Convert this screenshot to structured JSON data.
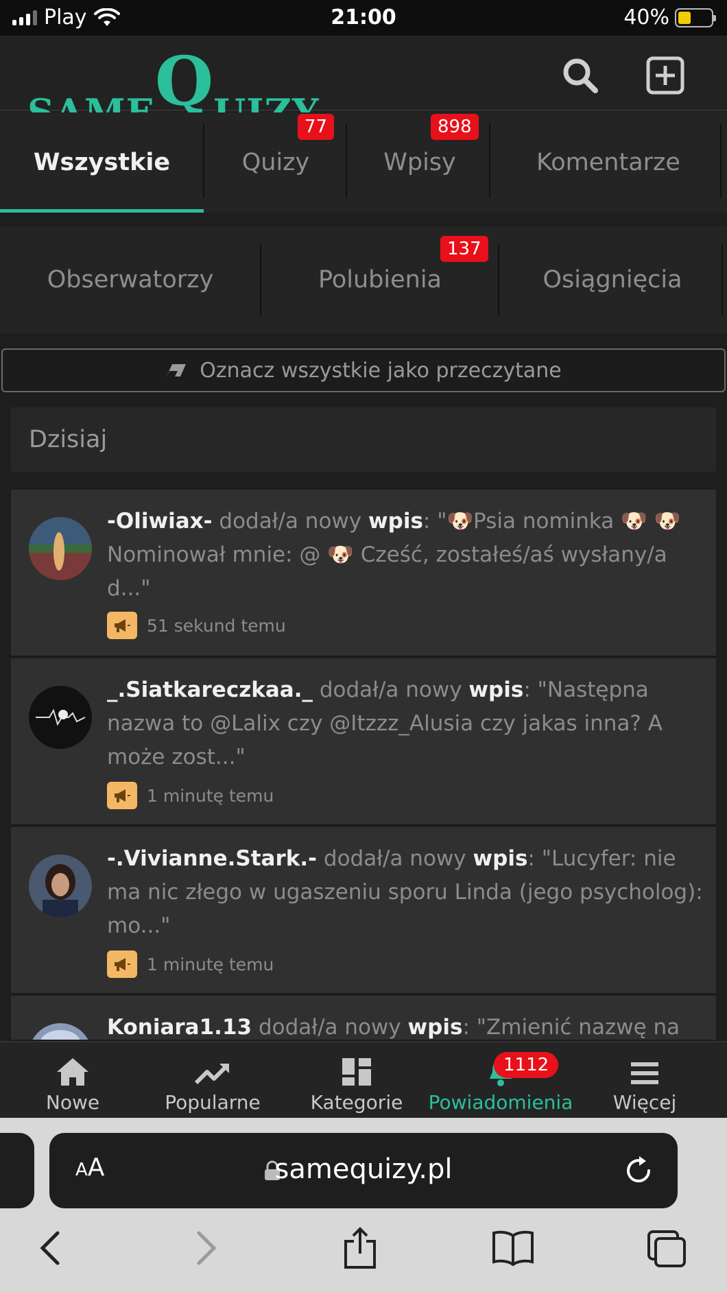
{
  "status": {
    "carrier": "Play",
    "time": "21:00",
    "battery": "40%",
    "battery_level": 0.4
  },
  "header": {
    "logo_part1": "SAME",
    "logo_part2": "Q",
    "logo_part3": "UIZY"
  },
  "tabs_row1": [
    {
      "label": "Wszystkie",
      "badge": ""
    },
    {
      "label": "Quizy",
      "badge": "77"
    },
    {
      "label": "Wpisy",
      "badge": "898"
    },
    {
      "label": "Komentarze",
      "badge": ""
    }
  ],
  "tabs_row2": [
    {
      "label": "Obserwatorzy",
      "badge": ""
    },
    {
      "label": "Polubienia",
      "badge": "137"
    },
    {
      "label": "Osiągnięcia",
      "badge": ""
    }
  ],
  "mark_all_label": "Oznacz wszystkie jako przeczytane",
  "day_header": "Dzisiaj",
  "notifications": [
    {
      "user": "-Oliwiax-",
      "action": " dodał/a nowy ",
      "type": "wpis",
      "text": ": \"🐶Psia nominka 🐶 🐶 Nominował mnie: @ 🐶 Cześć, zostałeś/aś wysłany/a d...\"",
      "time": "51 sekund temu"
    },
    {
      "user": "_.Siatkareczkaa._",
      "action": " dodał/a nowy ",
      "type": "wpis",
      "text": ": \"Następna nazwa to @Lalix czy @Itzzz_Alusia czy jakas inna? A może zost...\"",
      "time": "1 minutę temu"
    },
    {
      "user": "-.Vivianne.Stark.-",
      "action": " dodał/a nowy ",
      "type": "wpis",
      "text": ": \"Lucyfer: nie ma nic złego w ugaszeniu sporu Linda (jego psycholog): mo...\"",
      "time": "1 minutę temu"
    },
    {
      "user": "Koniara1.13",
      "action": " dodał/a nowy ",
      "type": "wpis",
      "text": ": \"Zmienić nazwę na",
      "time": ""
    }
  ],
  "bottom_nav": [
    {
      "label": "Nowe",
      "icon": "home-icon"
    },
    {
      "label": "Popularne",
      "icon": "trending-icon"
    },
    {
      "label": "Kategorie",
      "icon": "grid-icon"
    },
    {
      "label": "Powiadomienia",
      "icon": "bell-icon",
      "badge": "1112"
    },
    {
      "label": "Więcej",
      "icon": "menu-icon"
    }
  ],
  "browser": {
    "aa_small": "A",
    "aa_large": "A",
    "url": "samequizy.pl"
  },
  "colors": {
    "accent": "#2bbf9c",
    "badge": "#e8101a",
    "megaphone": "#f4b865"
  }
}
